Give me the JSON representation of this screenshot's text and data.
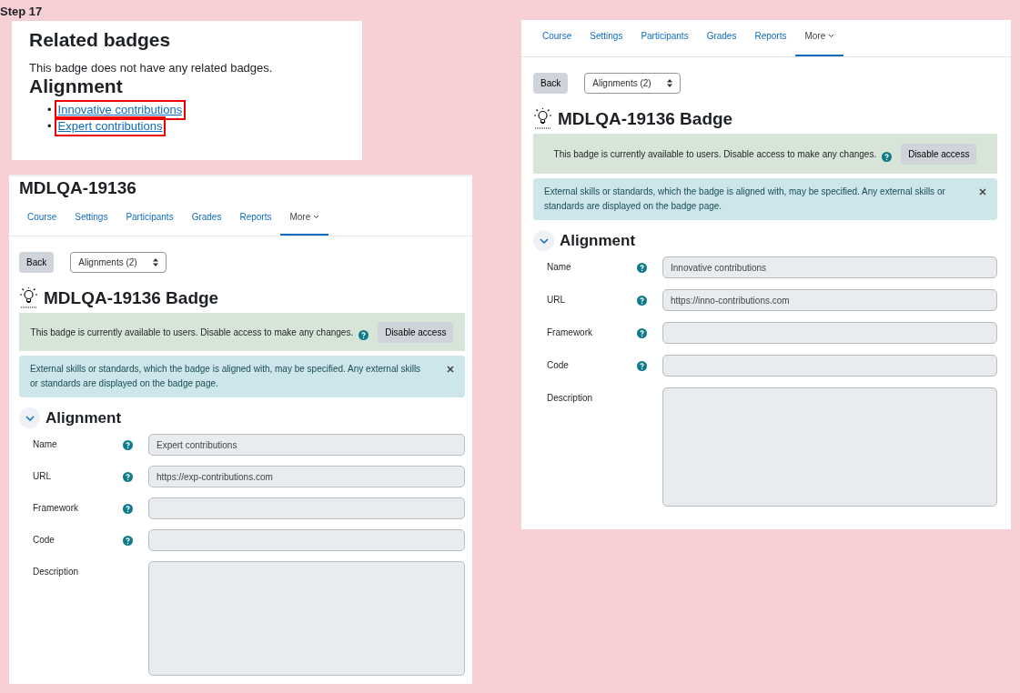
{
  "step_label": "Step 17",
  "related_panel": {
    "heading": "Related badges",
    "text": "This badge does not have any related badges.",
    "alignment_heading": "Alignment",
    "links": [
      {
        "marker": "•",
        "label": "Innovative contributions",
        "highlighted": true
      },
      {
        "marker": "•",
        "label": "Expert contributions",
        "highlighted": true
      }
    ]
  },
  "pages": [
    {
      "course_title": "MDLQA-19136",
      "tabs": [
        {
          "label": "Course",
          "kind": "link",
          "selected": false
        },
        {
          "label": "Settings",
          "kind": "link",
          "selected": false
        },
        {
          "label": "Participants",
          "kind": "link",
          "selected": false
        },
        {
          "label": "Grades",
          "kind": "link",
          "selected": false
        },
        {
          "label": "Reports",
          "kind": "link",
          "selected": false
        },
        {
          "label": "More",
          "kind": "menu",
          "selected": true
        }
      ],
      "back_button": "Back",
      "alignments_select": "Alignments (2)",
      "badge_title": "MDLQA-19136 Badge",
      "status_message": "This badge is currently available to users. Disable access to make any changes.",
      "disable_button": "Disable access",
      "info_message": "External skills or standards, which the badge is aligned with, may be specified. Any external skills or standards are displayed on the badge page.",
      "section": {
        "title": "Alignment",
        "expanded": true
      },
      "fields": [
        {
          "label": "Name",
          "kind": "text",
          "help": true,
          "value": "Expert contributions"
        },
        {
          "label": "URL",
          "kind": "text",
          "help": true,
          "value": "https://exp-contributions.com"
        },
        {
          "label": "Framework",
          "kind": "text",
          "help": true
        },
        {
          "label": "Code",
          "kind": "text",
          "help": true
        },
        {
          "label": "Description",
          "kind": "textarea",
          "help": false
        }
      ]
    },
    {
      "tabs": [
        {
          "label": "Course",
          "kind": "link",
          "selected": false
        },
        {
          "label": "Settings",
          "kind": "link",
          "selected": false
        },
        {
          "label": "Participants",
          "kind": "link",
          "selected": false
        },
        {
          "label": "Grades",
          "kind": "link",
          "selected": false
        },
        {
          "label": "Reports",
          "kind": "link",
          "selected": false
        },
        {
          "label": "More",
          "kind": "menu",
          "selected": true
        }
      ],
      "back_button": "Back",
      "alignments_select": "Alignments (2)",
      "badge_title": "MDLQA-19136 Badge",
      "status_message": "This badge is currently available to users. Disable access to make any changes.",
      "disable_button": "Disable access",
      "info_message": "External skills or standards, which the badge is aligned with, may be specified. Any external skills or standards are displayed on the badge page.",
      "section": {
        "title": "Alignment",
        "expanded": true
      },
      "fields": [
        {
          "label": "Name",
          "kind": "text",
          "help": true,
          "value": "Innovative contributions"
        },
        {
          "label": "URL",
          "kind": "text",
          "help": true,
          "value": "https://inno-contributions.com"
        },
        {
          "label": "Framework",
          "kind": "text",
          "help": true
        },
        {
          "label": "Code",
          "kind": "text",
          "help": true
        },
        {
          "label": "Description",
          "kind": "textarea",
          "help": false
        }
      ]
    }
  ]
}
